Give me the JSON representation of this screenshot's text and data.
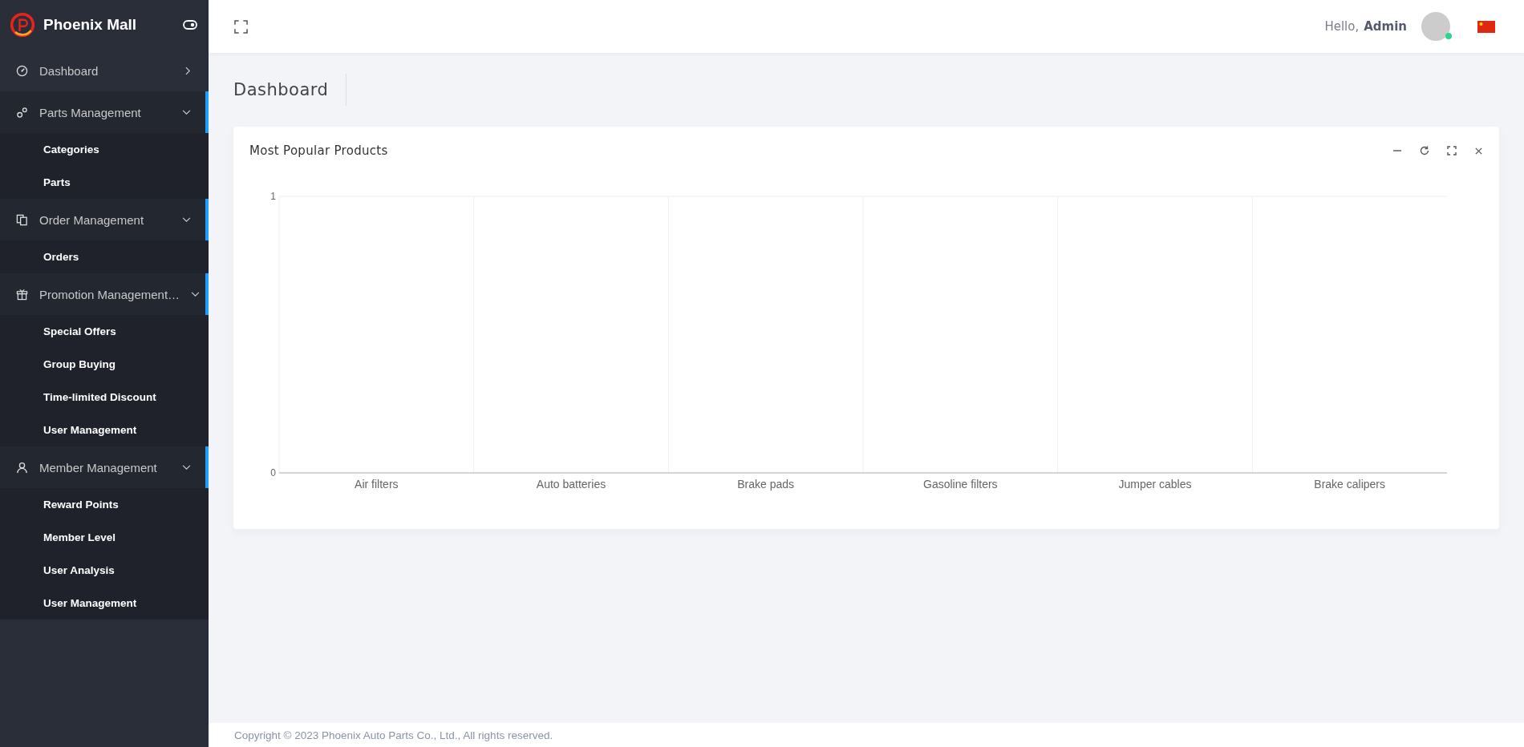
{
  "sidebar": {
    "brand": "Phoenix Mall",
    "items": [
      {
        "label": "Dashboard",
        "expanded": false
      },
      {
        "label": "Parts Management",
        "expanded": true,
        "children": [
          {
            "label": "Categories"
          },
          {
            "label": "Parts"
          }
        ]
      },
      {
        "label": "Order Management",
        "expanded": true,
        "children": [
          {
            "label": "Orders"
          }
        ]
      },
      {
        "label": "Promotion Management…",
        "expanded": true,
        "children": [
          {
            "label": "Special Offers"
          },
          {
            "label": "Group Buying"
          },
          {
            "label": "Time-limited Discount"
          },
          {
            "label": "User Management"
          }
        ]
      },
      {
        "label": "Member Management",
        "expanded": true,
        "children": [
          {
            "label": "Reward Points"
          },
          {
            "label": "Member Level"
          },
          {
            "label": "User Analysis"
          },
          {
            "label": "User Management"
          }
        ]
      }
    ]
  },
  "header": {
    "greeting": "Hello,",
    "user": "Admin",
    "online": true
  },
  "page_title": "Dashboard",
  "card": {
    "title": "Most Popular Products",
    "chart_data": {
      "type": "bar",
      "categories": [
        "Air filters",
        "Auto batteries",
        "Brake pads",
        "Gasoline filters",
        "Jumper cables",
        "Brake calipers"
      ],
      "values": [
        0,
        0,
        0,
        0,
        0,
        0
      ],
      "ylim": [
        0,
        1
      ],
      "yticks": [
        0,
        1
      ]
    }
  },
  "footer": "Copyright © 2023 Phoenix Auto Parts Co., Ltd., All rights reserved."
}
